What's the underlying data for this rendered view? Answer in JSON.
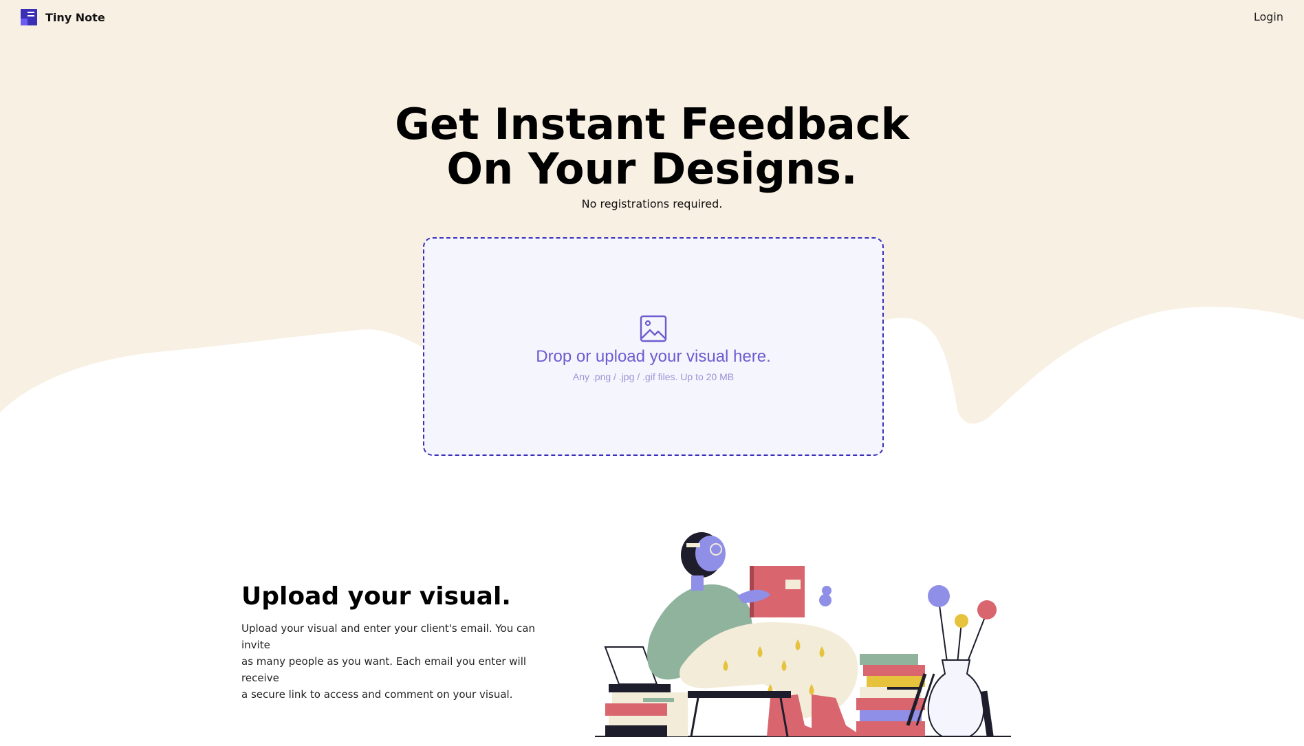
{
  "nav": {
    "brand_name": "Tiny Note",
    "brand_icon": "note-logo-icon",
    "login_label": "Login"
  },
  "hero": {
    "title_line1": "Get Instant Feedback",
    "title_line2": "On Your Designs.",
    "subtitle": "No registrations required."
  },
  "dropzone": {
    "icon": "image-icon",
    "title": "Drop or upload your visual here.",
    "subtitle": "Any .png / .jpg / .gif files. Up to 20 MB"
  },
  "feature": {
    "title": "Upload your visual.",
    "line1": "Upload your visual and enter your client's email. You can invite",
    "line2": "as many people as you want. Each email you enter will receive",
    "line3": "a secure link to access and comment on your visual."
  },
  "colors": {
    "hero_background": "#f8f0e3",
    "accent": "#3b2fb8",
    "dropzone_background": "#f4f5fd",
    "dropzone_text": "#6b5cd1"
  }
}
